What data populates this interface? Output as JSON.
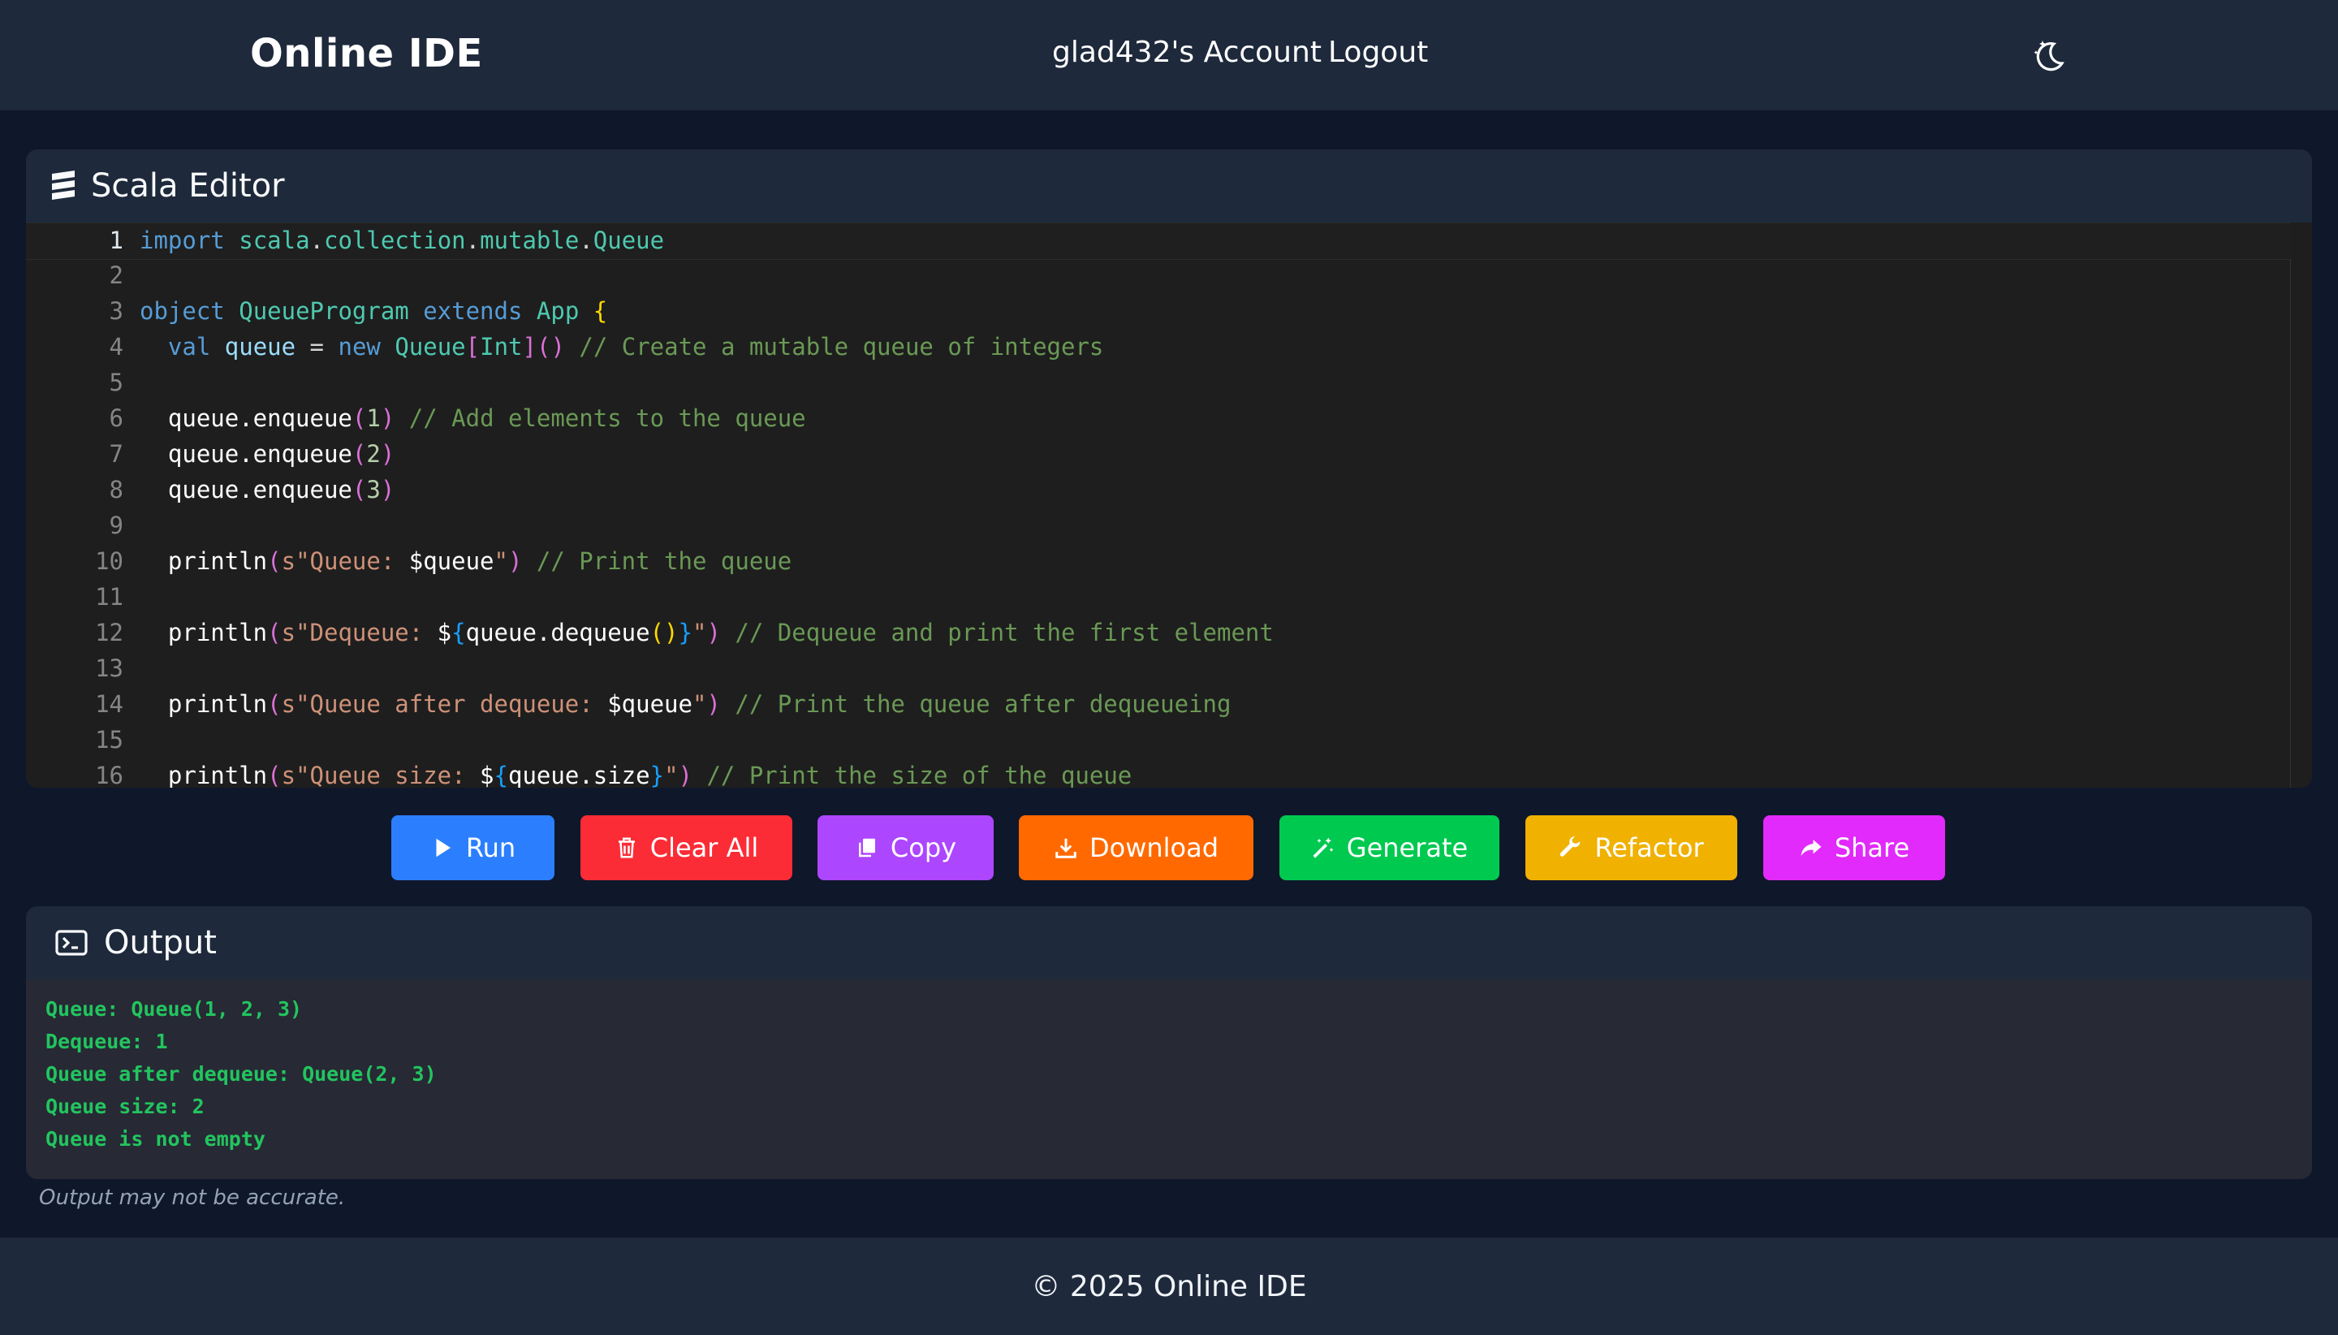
{
  "header": {
    "brand": "Online IDE",
    "account_label": "glad432's Account",
    "logout_label": "Logout",
    "theme_icon": "moon-stars-icon"
  },
  "editor": {
    "title": "Scala Editor",
    "icon": "stack-icon",
    "lines": [
      {
        "n": "1",
        "segs": [
          [
            "import",
            "kw"
          ],
          [
            " ",
            ""
          ],
          [
            "scala",
            "ty"
          ],
          [
            ".",
            ""
          ],
          [
            "collection",
            "ty"
          ],
          [
            ".",
            ""
          ],
          [
            "mutable",
            "ty"
          ],
          [
            ".",
            ""
          ],
          [
            "Queue",
            "ty"
          ]
        ]
      },
      {
        "n": "2",
        "segs": []
      },
      {
        "n": "3",
        "segs": [
          [
            "object",
            "kw"
          ],
          [
            " ",
            ""
          ],
          [
            "QueueProgram",
            "ty"
          ],
          [
            " ",
            ""
          ],
          [
            "extends",
            "kw"
          ],
          [
            " ",
            ""
          ],
          [
            "App",
            "ty"
          ],
          [
            " ",
            ""
          ],
          [
            "{",
            "pn2"
          ]
        ]
      },
      {
        "n": "4",
        "segs": [
          [
            "  ",
            ""
          ],
          [
            "val",
            "kw"
          ],
          [
            " ",
            ""
          ],
          [
            "queue",
            "vr"
          ],
          [
            " = ",
            ""
          ],
          [
            "new",
            "kw"
          ],
          [
            " ",
            ""
          ],
          [
            "Queue",
            "ty"
          ],
          [
            "[",
            "pn1"
          ],
          [
            "Int",
            "ty"
          ],
          [
            "]",
            "pn1"
          ],
          [
            "()",
            "pn1"
          ],
          [
            " ",
            ""
          ],
          [
            "// Create a mutable queue of integers",
            "cm"
          ]
        ]
      },
      {
        "n": "5",
        "segs": []
      },
      {
        "n": "6",
        "segs": [
          [
            "  queue.enqueue",
            "wh"
          ],
          [
            "(",
            "pn1"
          ],
          [
            "1",
            "nm"
          ],
          [
            ")",
            "pn1"
          ],
          [
            " ",
            ""
          ],
          [
            "// Add elements to the queue",
            "cm"
          ]
        ]
      },
      {
        "n": "7",
        "segs": [
          [
            "  queue.enqueue",
            "wh"
          ],
          [
            "(",
            "pn1"
          ],
          [
            "2",
            "nm"
          ],
          [
            ")",
            "pn1"
          ]
        ]
      },
      {
        "n": "8",
        "segs": [
          [
            "  queue.enqueue",
            "wh"
          ],
          [
            "(",
            "pn1"
          ],
          [
            "3",
            "nm"
          ],
          [
            ")",
            "pn1"
          ]
        ]
      },
      {
        "n": "9",
        "segs": []
      },
      {
        "n": "10",
        "segs": [
          [
            "  println",
            "wh"
          ],
          [
            "(",
            "pn1"
          ],
          [
            "s\"Queue: ",
            "st"
          ],
          [
            "$queue",
            "wh"
          ],
          [
            "\"",
            "st"
          ],
          [
            ")",
            "pn1"
          ],
          [
            " ",
            ""
          ],
          [
            "// Print the queue",
            "cm"
          ]
        ]
      },
      {
        "n": "11",
        "segs": []
      },
      {
        "n": "12",
        "segs": [
          [
            "  println",
            "wh"
          ],
          [
            "(",
            "pn1"
          ],
          [
            "s\"Dequeue: ",
            "st"
          ],
          [
            "$",
            "wh"
          ],
          [
            "{",
            "pn3"
          ],
          [
            "queue.dequeue",
            "wh"
          ],
          [
            "()",
            "pn2"
          ],
          [
            "}",
            "pn3"
          ],
          [
            "\"",
            "st"
          ],
          [
            ")",
            "pn1"
          ],
          [
            " ",
            ""
          ],
          [
            "// Dequeue and print the first element",
            "cm"
          ]
        ]
      },
      {
        "n": "13",
        "segs": []
      },
      {
        "n": "14",
        "segs": [
          [
            "  println",
            "wh"
          ],
          [
            "(",
            "pn1"
          ],
          [
            "s\"Queue after dequeue: ",
            "st"
          ],
          [
            "$queue",
            "wh"
          ],
          [
            "\"",
            "st"
          ],
          [
            ")",
            "pn1"
          ],
          [
            " ",
            ""
          ],
          [
            "// Print the queue after dequeueing",
            "cm"
          ]
        ]
      },
      {
        "n": "15",
        "segs": []
      },
      {
        "n": "16",
        "segs": [
          [
            "  println",
            "wh"
          ],
          [
            "(",
            "pn1"
          ],
          [
            "s\"Queue size: ",
            "st"
          ],
          [
            "$",
            "wh"
          ],
          [
            "{",
            "pn3"
          ],
          [
            "queue.size",
            "wh"
          ],
          [
            "}",
            "pn3"
          ],
          [
            "\"",
            "st"
          ],
          [
            ")",
            "pn1"
          ],
          [
            " ",
            ""
          ],
          [
            "// Print the size of the queue",
            "cm"
          ]
        ]
      }
    ]
  },
  "toolbar": {
    "buttons": [
      {
        "label": "Run",
        "icon": "play-icon",
        "color": "#2b7fff"
      },
      {
        "label": "Clear All",
        "icon": "trash-icon",
        "color": "#fb2c36"
      },
      {
        "label": "Copy",
        "icon": "copy-icon",
        "color": "#ad46ff"
      },
      {
        "label": "Download",
        "icon": "download-icon",
        "color": "#ff6900"
      },
      {
        "label": "Generate",
        "icon": "magic-wand-icon",
        "color": "#00c950"
      },
      {
        "label": "Refactor",
        "icon": "wrench-icon",
        "color": "#f0b100"
      },
      {
        "label": "Share",
        "icon": "share-icon",
        "color": "#e12afb"
      }
    ]
  },
  "output": {
    "title": "Output",
    "icon": "terminal-icon",
    "lines": [
      "Queue: Queue(1, 2, 3)",
      "Dequeue: 1",
      "Queue after dequeue: Queue(2, 3)",
      "Queue size: 2",
      "Queue is not empty"
    ],
    "disclaimer": "Output may not be accurate."
  },
  "footer": {
    "text": "© 2025 Online IDE"
  }
}
